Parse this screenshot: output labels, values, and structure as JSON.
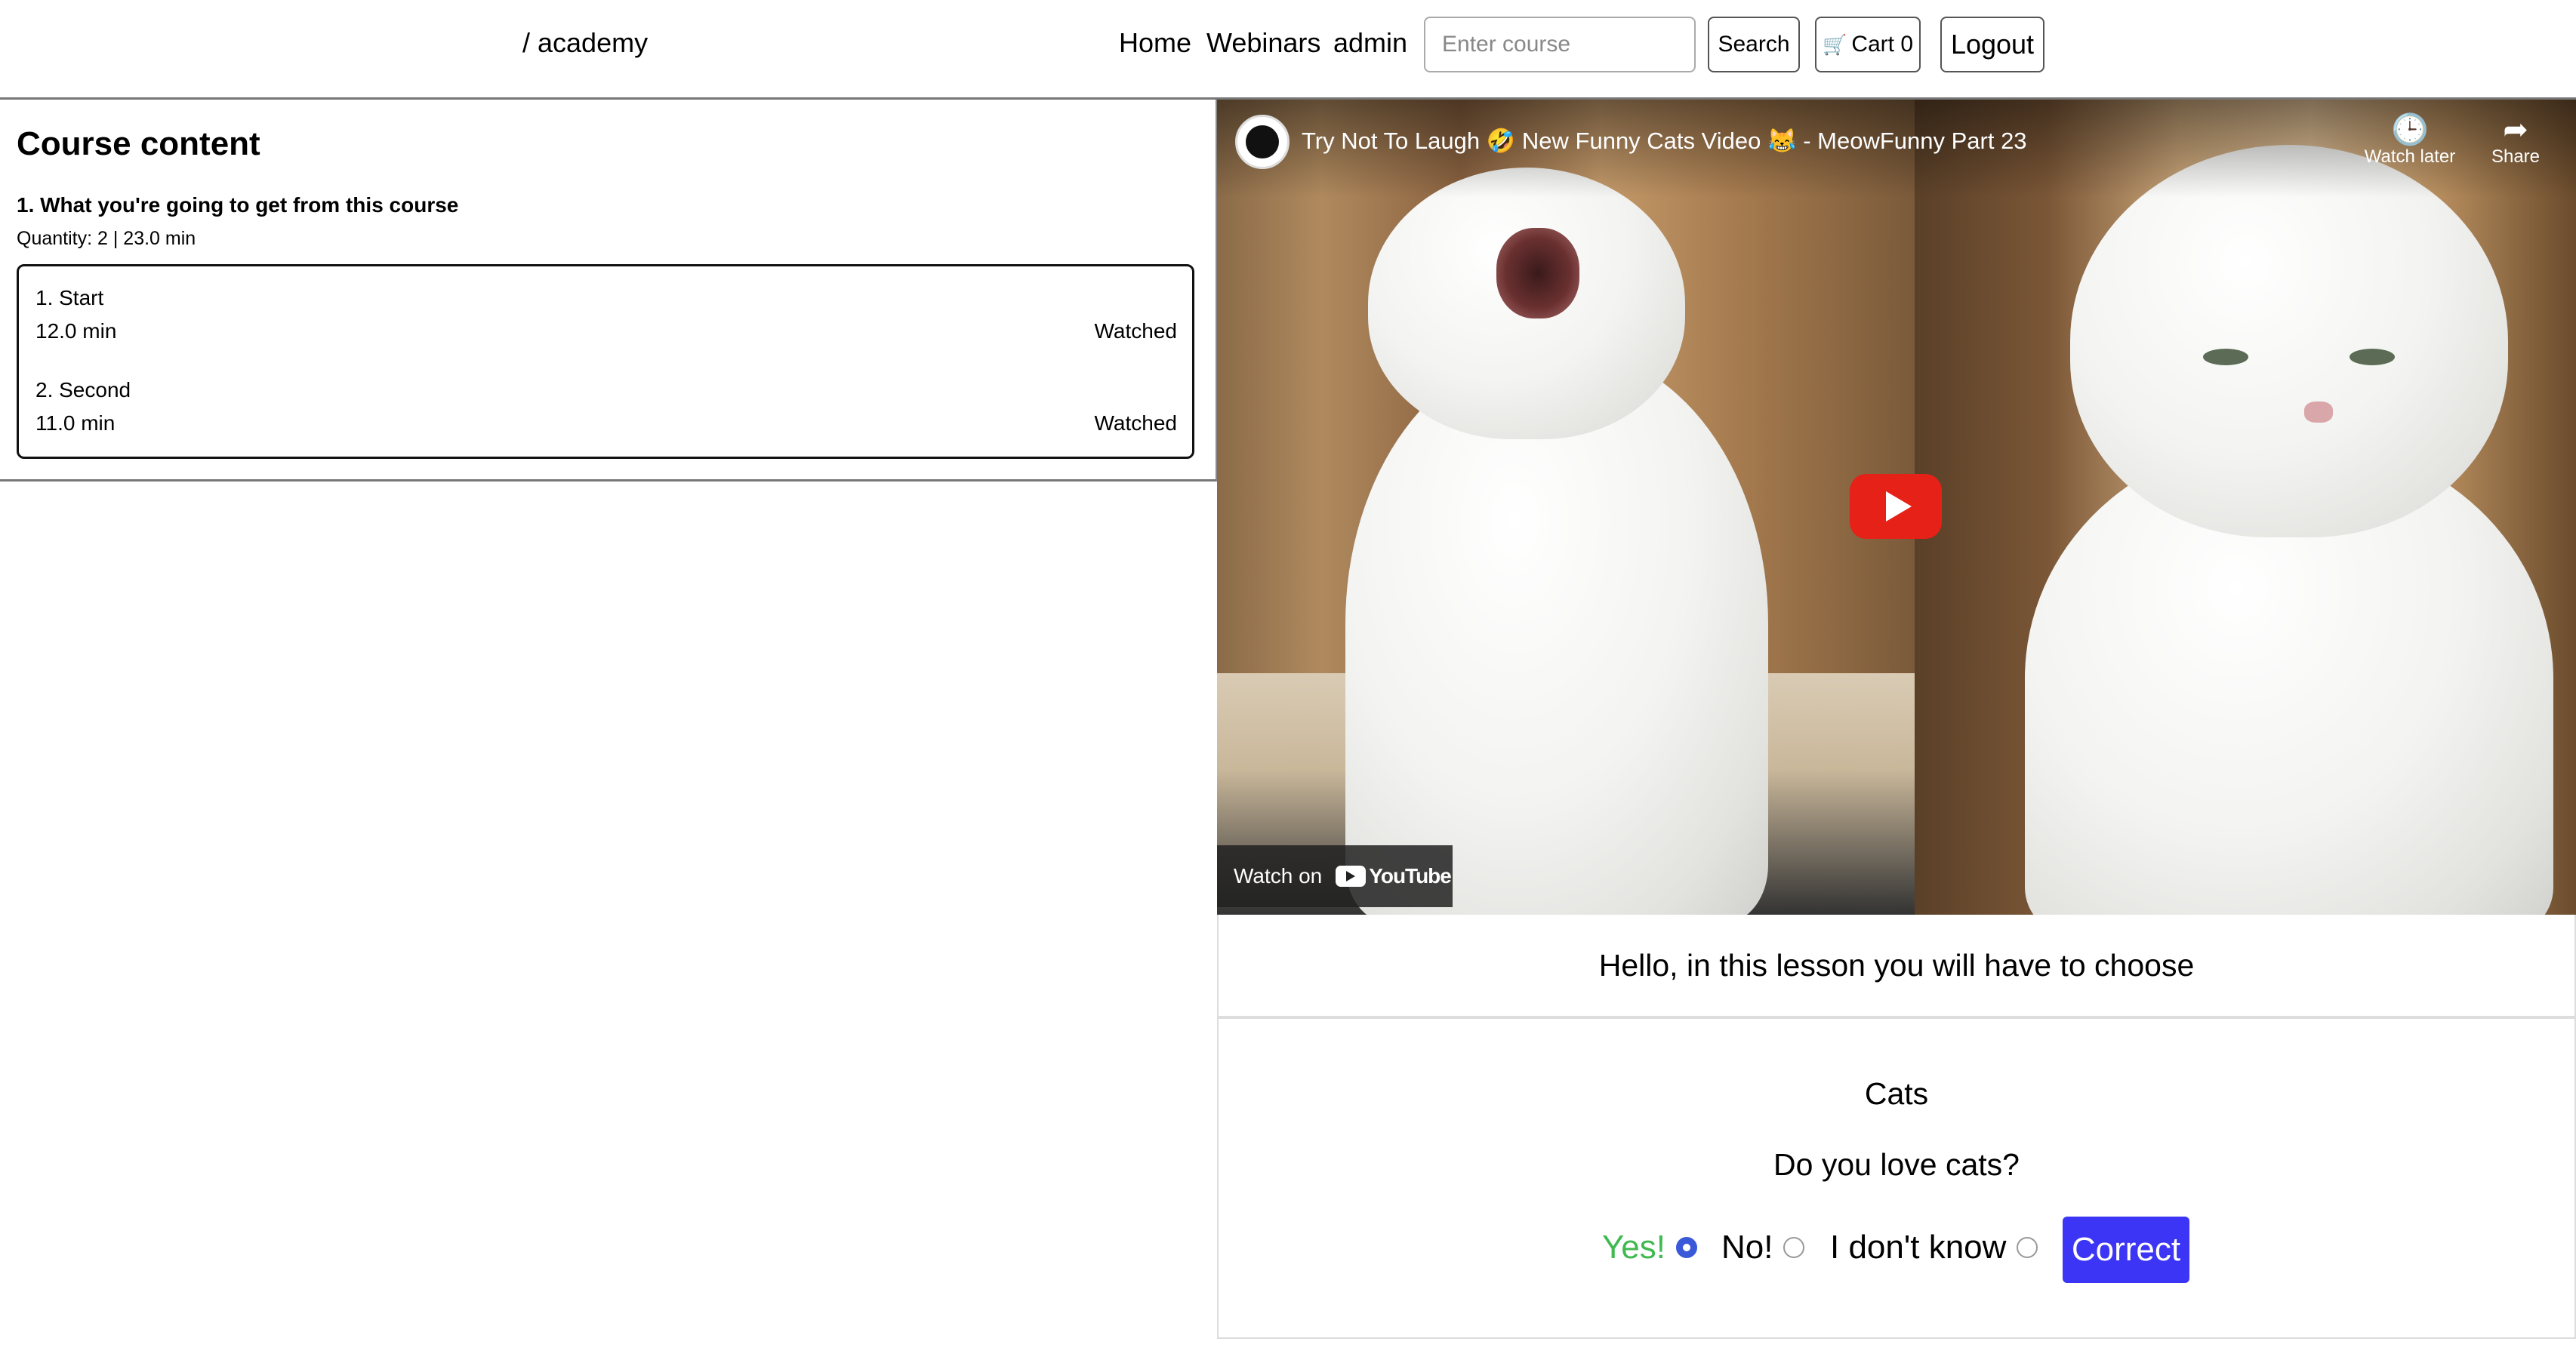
{
  "header": {
    "brand": "/ academy",
    "nav": {
      "home": "Home",
      "webinars": "Webinars",
      "user": "admin"
    },
    "search": {
      "placeholder": "Enter course",
      "button": "Search"
    },
    "cart": {
      "label": "Cart 0"
    },
    "logout": "Logout"
  },
  "course": {
    "title": "Course content",
    "section": {
      "title": "1. What you're going to get from this course",
      "meta": "Quantity: 2 | 23.0 min",
      "lessons": [
        {
          "name": "1. Start",
          "duration": "12.0 min",
          "status": "Watched"
        },
        {
          "name": "2. Second",
          "duration": "11.0 min",
          "status": "Watched"
        }
      ]
    }
  },
  "video": {
    "title": "Try Not To Laugh 🤣 New Funny Cats Video 😹 - MeowFunny Part 23",
    "watch_later": "Watch later",
    "share": "Share",
    "watch_on": "Watch on",
    "youtube": "YouTube"
  },
  "lesson": {
    "intro": "Hello, in this lesson you will have to choose"
  },
  "quiz": {
    "title": "Cats",
    "question": "Do you love cats?",
    "answers": [
      {
        "label": "Yes!",
        "selected": true,
        "color": "#3fb950"
      },
      {
        "label": "No!",
        "selected": false
      },
      {
        "label": "I don't know",
        "selected": false
      }
    ],
    "result_button": "Correct",
    "result_color": "#3d35f5"
  }
}
